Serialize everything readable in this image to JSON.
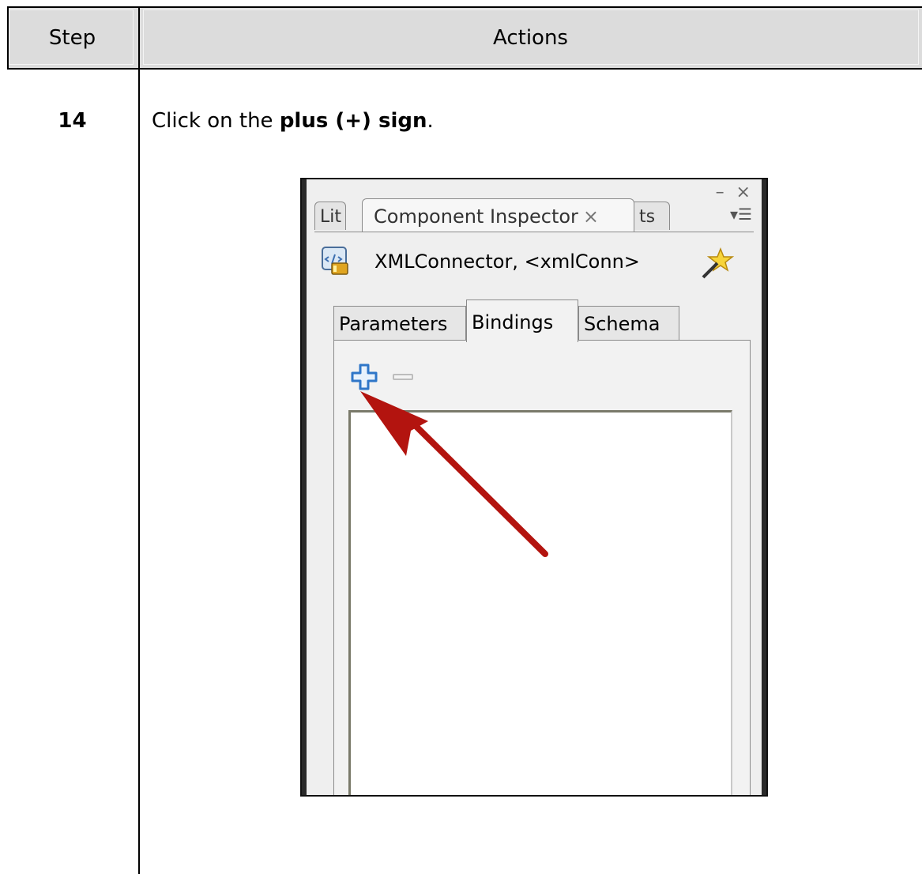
{
  "table": {
    "header": {
      "step": "Step",
      "actions": "Actions"
    },
    "row": {
      "step_number": "14",
      "instruction_prefix": "Click on the ",
      "instruction_bold": "plus (+) sign",
      "instruction_suffix": "."
    }
  },
  "panel": {
    "window_controls": "– ×",
    "tabs": [
      {
        "label": "Lit"
      },
      {
        "label": "Component Inspector",
        "close": "×"
      },
      {
        "label": "ts"
      }
    ],
    "menu_icon": "▾☰",
    "component_label": "XMLConnector, <xmlConn>",
    "subtabs": [
      {
        "label": "Parameters"
      },
      {
        "label": "Bindings"
      },
      {
        "label": "Schema"
      }
    ],
    "active_subtab": "Bindings"
  },
  "colors": {
    "header_bg": "#dcdcdc",
    "arrow": "#b3140f",
    "plus_icon": "#2f76c8"
  },
  "icons": [
    "xml-connector-icon",
    "wand-icon",
    "plus-icon",
    "minus-icon",
    "annotation-arrow",
    "close-icon",
    "panel-menu-icon"
  ]
}
